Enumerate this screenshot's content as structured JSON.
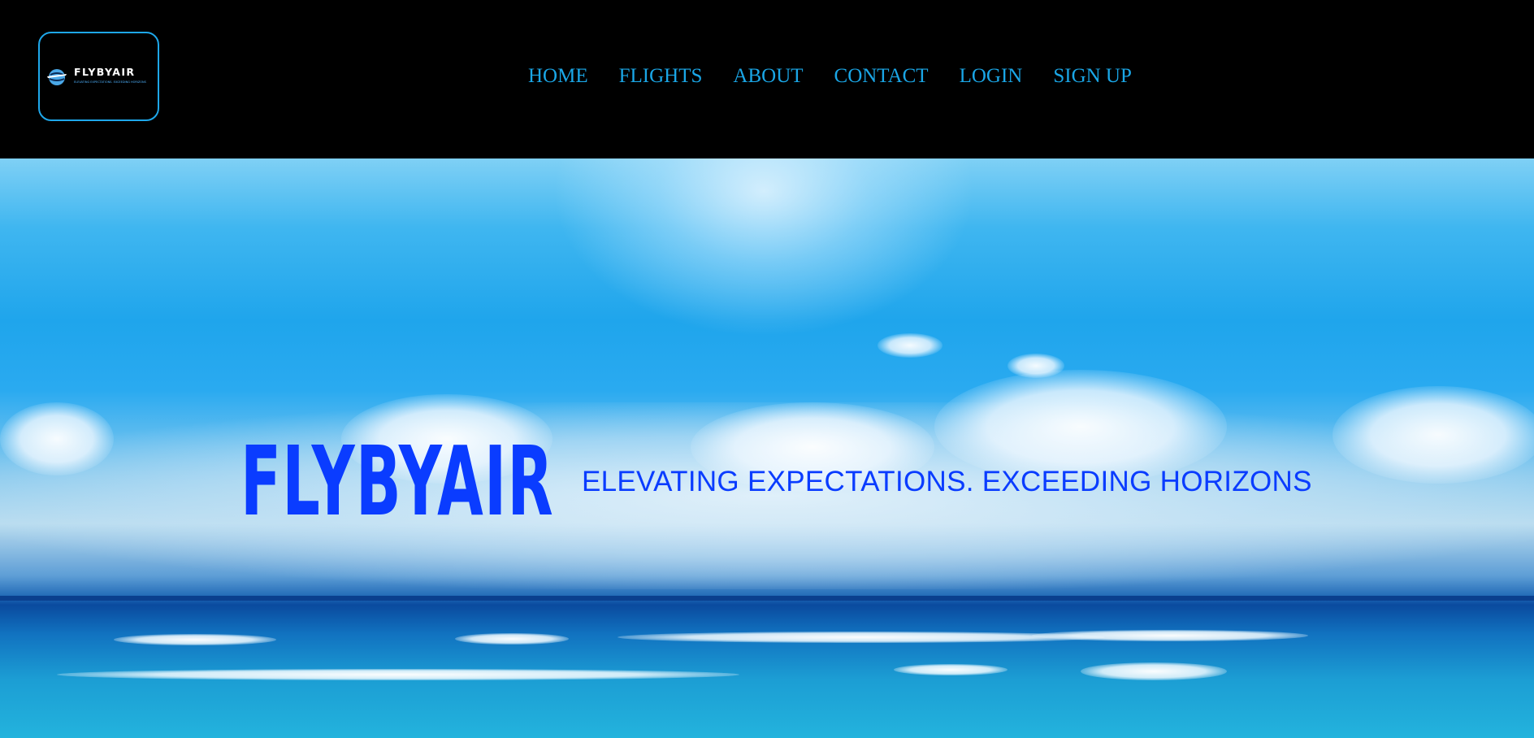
{
  "brand": {
    "logo_wordmark": "FLYBYAIR",
    "logo_tagline": "ELEVATING EXPECTATIONS. EXCEEDING HORIZONS",
    "accent_color": "#1aa6e6",
    "hero_text_color": "#0a3cff"
  },
  "nav": {
    "items": [
      {
        "label": "HOME"
      },
      {
        "label": "FLIGHTS"
      },
      {
        "label": "ABOUT"
      },
      {
        "label": "CONTACT"
      },
      {
        "label": "LOGIN"
      },
      {
        "label": "SIGN UP"
      }
    ]
  },
  "hero": {
    "title": "FLYBYAIR",
    "tagline": "ELEVATING EXPECTATIONS. EXCEEDING HORIZONS",
    "background": "sky-and-ocean-image"
  }
}
